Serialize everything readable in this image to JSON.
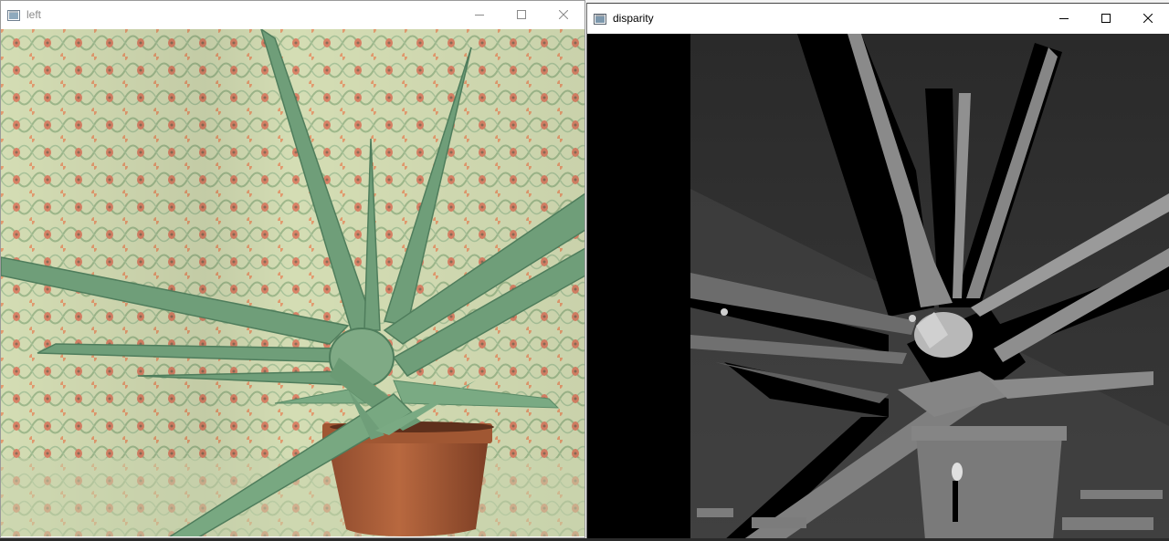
{
  "windows": {
    "left": {
      "title": "left",
      "icon": "window-app-icon",
      "content": "stereo-left-image-aloe"
    },
    "disparity": {
      "title": "disparity",
      "icon": "window-app-icon",
      "content": "grayscale-disparity-map"
    }
  },
  "caption_buttons": [
    "minimize-icon",
    "maximize-icon",
    "close-icon"
  ],
  "colors": {
    "window_bg": "#ffffff",
    "inactive_title": "#8a8a8a",
    "active_title": "#000000",
    "disparity_bg": "#000000",
    "plant_green": "#6f9e79",
    "pot": "#a55a35",
    "wallpaper": "#cfdcaf"
  }
}
